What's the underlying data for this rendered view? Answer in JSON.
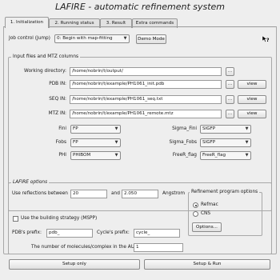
{
  "window": {
    "title": "LAFIRE - automatic refinement system"
  },
  "tabs": [
    {
      "label": "1. Initialization"
    },
    {
      "label": "2. Running status"
    },
    {
      "label": "3. Result"
    },
    {
      "label": "Extra commands"
    }
  ],
  "job_control": {
    "label": "Job control (Jump)",
    "value": "0: Begin with map-fitting",
    "demo_button": "Demo Mode"
  },
  "icons": {
    "whats_this": "whats-this-icon",
    "combo_arrow": "▼"
  },
  "input_files": {
    "section_title": "Input files and MTZ columns",
    "working_dir_label": "Working directory:",
    "working_dir_value": "/home/nobrin/t/output/",
    "pdb_label": "PDB IN:",
    "pdb_value": "/home/nobrin/t/example/PH1061_init.pdb",
    "seq_label": "SEQ IN:",
    "seq_value": "/home/nobrin/t/example/PH1061_seq.txt",
    "mtz_label": "MTZ IN:",
    "mtz_value": "/home/nobrin/t/example/PH1061_remote.mtz",
    "browse_label": "...",
    "view_label": "view"
  },
  "mtz_columns": {
    "fini_label": "Fini",
    "fini_value": "FP",
    "fobs_label": "Fobs",
    "fobs_value": "FP",
    "phi_label": "PHI",
    "phi_value": "PHIBOM",
    "sigma_fini_label": "Sigma_Fini",
    "sigma_fini_value": "SIGFP",
    "sigma_fobs_label": "Sigma_Fobs",
    "sigma_fobs_value": "SIGFP",
    "freer_label": "FreeR_flag",
    "freer_value": "FreeR_flag"
  },
  "options": {
    "section_title": "LAFIRE options",
    "reflections_label": "Use reflections between",
    "res_low": "20",
    "and_label": "and",
    "res_high": "2.050",
    "angstrom_label": "Angstrom",
    "mspp_label": "Use the building strategy (MSPP)",
    "pdb_prefix_label": "PDB's prefix:",
    "pdb_prefix_value": "pdb_",
    "cycle_prefix_label": "Cycle's prefix:",
    "cycle_prefix_value": "cycle_",
    "molecules_label": "The number of molecules/complex in the AU",
    "molecules_value": "1"
  },
  "refinement": {
    "section_title": "Refinement program options",
    "refmac_label": "Refmac",
    "cns_label": "CNS",
    "options_button": "Options..."
  },
  "footer": {
    "setup_only": "Setup only",
    "setup_run": "Setup & Run"
  }
}
